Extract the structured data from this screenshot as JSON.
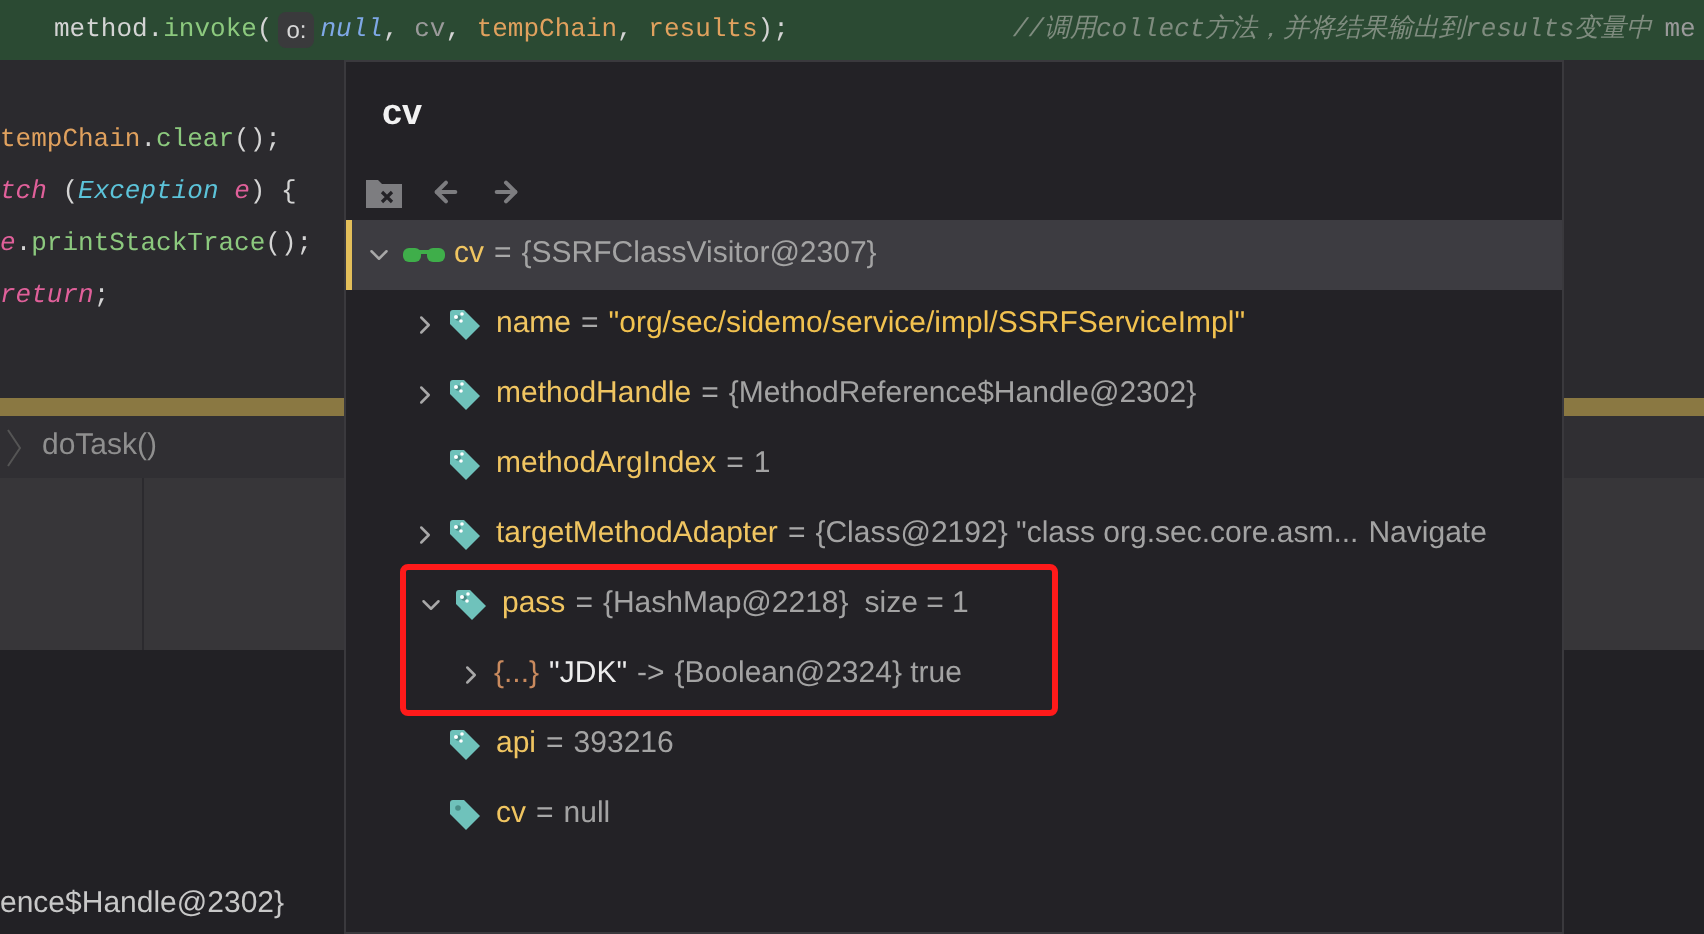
{
  "editor": {
    "lines": [
      {
        "current": true,
        "segments": [
          {
            "kind": "code",
            "tokens": [
              {
                "text": "method.",
                "kind": "plain"
              },
              {
                "text": "invoke",
                "kind": "method"
              },
              {
                "text": "(",
                "kind": "plain"
              }
            ]
          },
          {
            "kind": "hint",
            "text": "o:"
          },
          {
            "kind": "code",
            "tokens": [
              {
                "text": "null",
                "kind": "literal"
              },
              {
                "text": ",",
                "kind": "plain"
              },
              {
                "text": "cv",
                "kind": "dim"
              },
              {
                "text": ",",
                "kind": "plain"
              },
              {
                "text": "tempChain",
                "kind": "field"
              },
              {
                "text": ",",
                "kind": "plain"
              },
              {
                "text": "results",
                "kind": "field"
              },
              {
                "text": ");",
                "kind": "plain"
              }
            ]
          },
          {
            "kind": "comment",
            "text": "//调用collect方法，并将结果输出到results变量中"
          },
          {
            "kind": "code",
            "tokens": [
              {
                "text": "me",
                "kind": "dim"
              }
            ]
          }
        ]
      },
      {
        "current": false,
        "segments": [
          {
            "kind": "code",
            "tokens": [
              {
                "text": "tempChain",
                "kind": "field"
              },
              {
                "text": ".",
                "kind": "plain"
              },
              {
                "text": "clear",
                "kind": "method"
              },
              {
                "text": "();",
                "kind": "plain"
              }
            ]
          }
        ]
      },
      {
        "current": false,
        "segments": [
          {
            "kind": "code",
            "tokens": [
              {
                "text": "tch",
                "kind": "keyword"
              },
              {
                "text": "(",
                "kind": "plain"
              },
              {
                "text": "Exception",
                "kind": "type"
              },
              {
                "text": "e",
                "kind": "keyword"
              },
              {
                "text": ")",
                "kind": "plain"
              },
              {
                "text": "{",
                "kind": "plain"
              }
            ]
          }
        ]
      },
      {
        "current": false,
        "segments": [
          {
            "kind": "code",
            "tokens": [
              {
                "text": "e",
                "kind": "keyword"
              },
              {
                "text": ".",
                "kind": "plain"
              },
              {
                "text": "printStackTrace",
                "kind": "method"
              },
              {
                "text": "();",
                "kind": "plain"
              }
            ]
          }
        ]
      },
      {
        "current": false,
        "segments": [
          {
            "kind": "code",
            "tokens": [
              {
                "text": "return",
                "kind": "keyword"
              },
              {
                "text": ";",
                "kind": "plain"
              }
            ]
          }
        ]
      }
    ]
  },
  "breadcrumb": {
    "label": "doTask()"
  },
  "variables_value": "ence$Handle@2302}",
  "popup": {
    "title": "cv",
    "tree": {
      "kind": "watch",
      "name": "cv",
      "operator": "=",
      "value": "{SSRFClassVisitor@2307}",
      "expanded": true,
      "selected": true,
      "children": [
        {
          "kind": "string-field",
          "final": true,
          "name": "name",
          "operator": "=",
          "value": "\"org/sec/sidemo/service/impl/SSRFServiceImpl\"",
          "expanded": false,
          "selected": false
        },
        {
          "kind": "field",
          "final": true,
          "name": "methodHandle",
          "operator": "=",
          "value": "{MethodReference$Handle@2302}",
          "expanded": false,
          "selected": false
        },
        {
          "kind": "field",
          "final": true,
          "name": "methodArgIndex",
          "operator": "=",
          "value": "1",
          "selected": false
        },
        {
          "kind": "field",
          "final": true,
          "name": "targetMethodAdapter",
          "operator": "=",
          "value": "{Class@2192} \"class org.sec.core.asm...",
          "link": "Navigate",
          "expanded": false,
          "selected": false
        },
        {
          "kind": "field",
          "final": true,
          "name": "pass",
          "operator": "=",
          "value": "{HashMap@2218}",
          "extra": "size = 1",
          "expanded": true,
          "selected": false,
          "highlighted": true,
          "children": [
            {
              "kind": "entry",
              "badge": "{...}",
              "name": "\"JDK\"",
              "operator": "->",
              "value": "{Boolean@2324} true",
              "expanded": false,
              "selected": false
            }
          ]
        },
        {
          "kind": "field",
          "final": true,
          "name": "api",
          "operator": "=",
          "value": "393216",
          "selected": false
        },
        {
          "kind": "field",
          "final": false,
          "name": "cv",
          "operator": "=",
          "value": "null",
          "selected": false
        }
      ]
    }
  }
}
